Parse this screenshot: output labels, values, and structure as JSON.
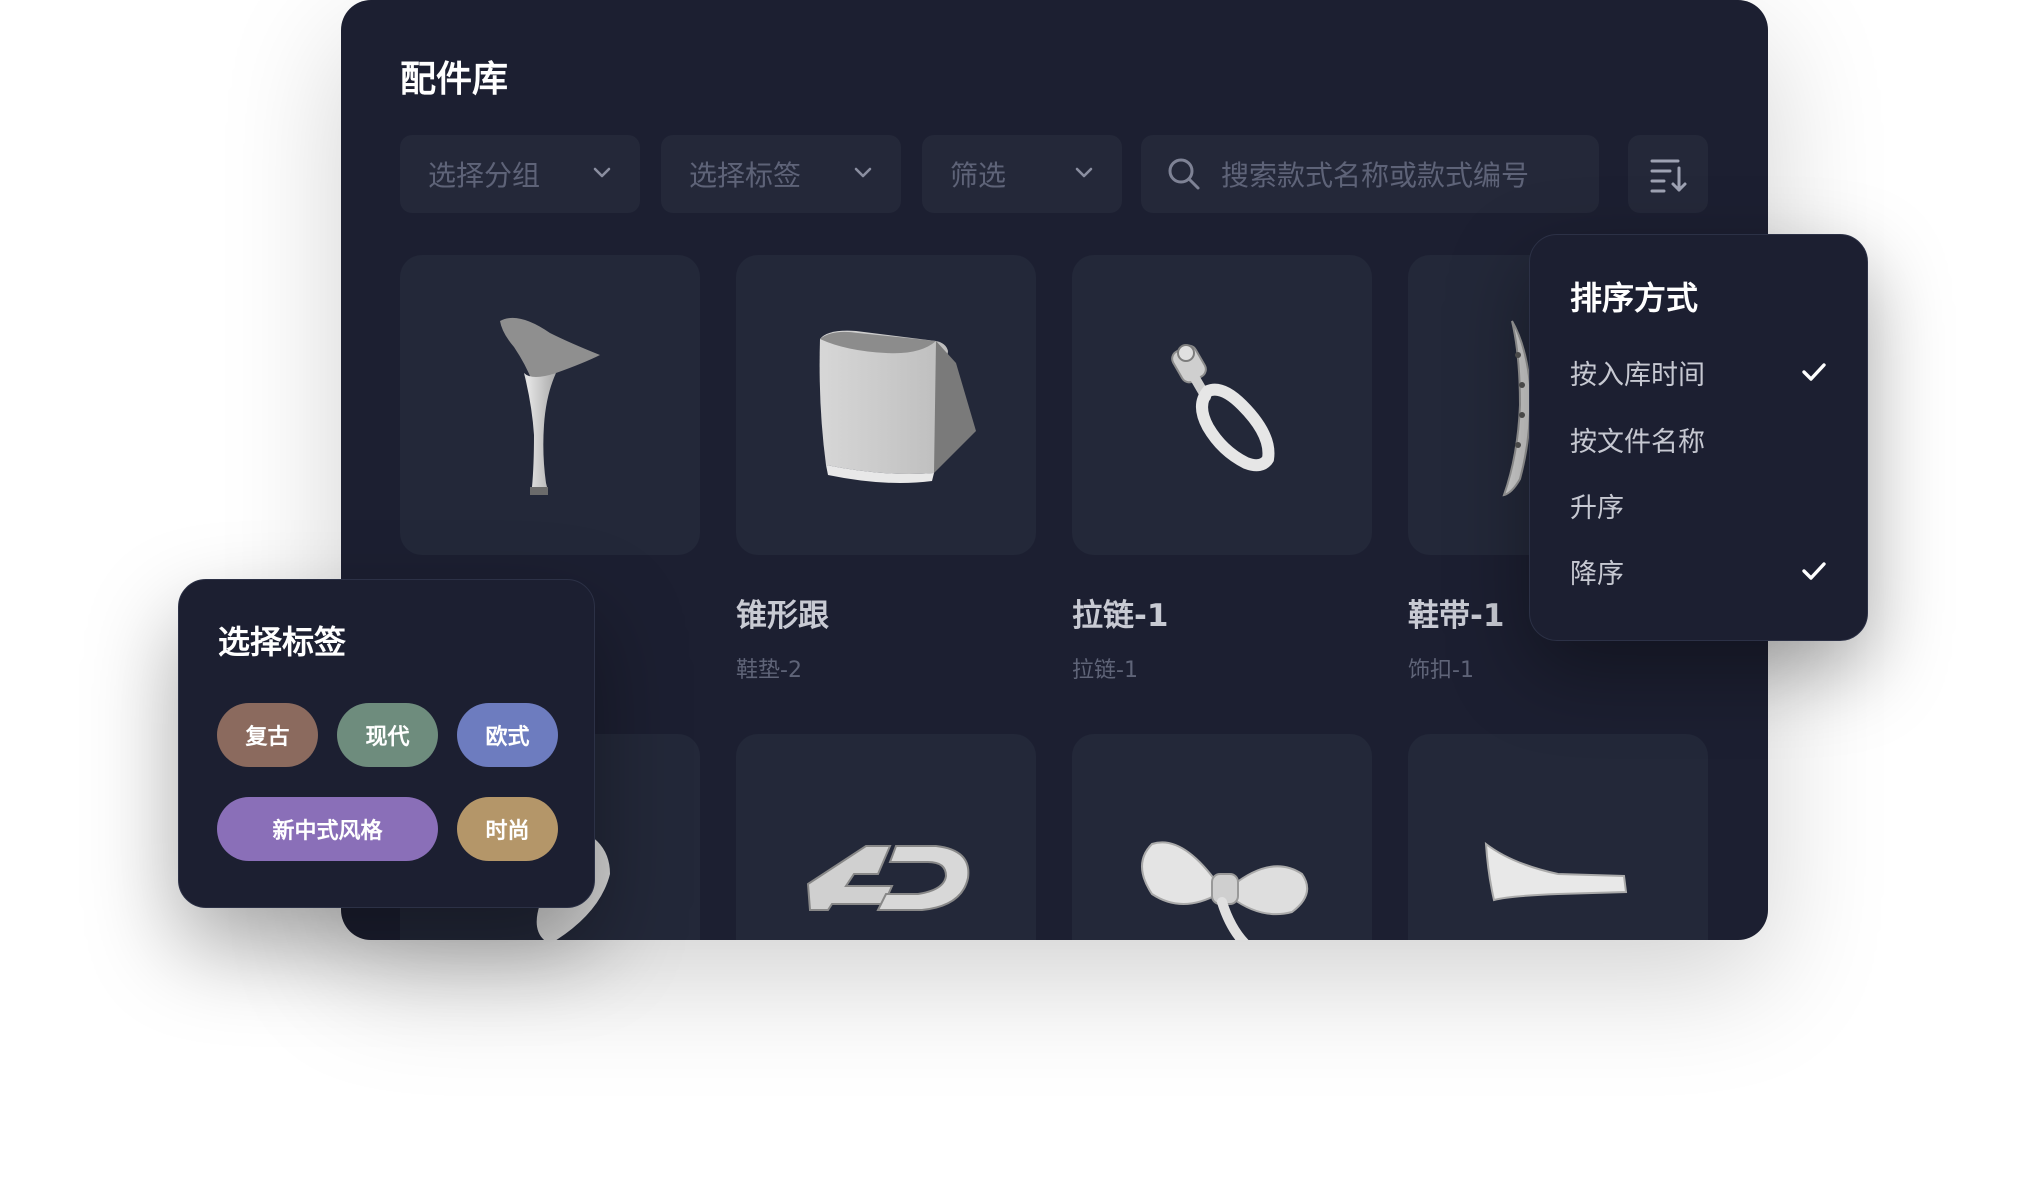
{
  "panel": {
    "title": "配件库",
    "filters": {
      "group_placeholder": "选择分组",
      "tag_placeholder": "选择标签",
      "filter_placeholder": "筛选"
    },
    "search": {
      "placeholder": "搜索款式名称或款式编号"
    }
  },
  "items": [
    {
      "name": "锥形跟",
      "sub": "鞋垫-2",
      "icon": "cone-heel-icon"
    },
    {
      "name": "拉链-1",
      "sub": "拉链-1",
      "icon": "zipper-pull-icon"
    },
    {
      "name": "鞋带-1",
      "sub": "饰扣-1",
      "icon": "strap-icon"
    }
  ],
  "sort_popup": {
    "title": "排序方式",
    "options": [
      {
        "label": "按入库时间",
        "checked": true
      },
      {
        "label": "按文件名称",
        "checked": false
      },
      {
        "label": "升序",
        "checked": false
      },
      {
        "label": "降序",
        "checked": true
      }
    ]
  },
  "tag_popup": {
    "title": "选择标签",
    "tags": [
      {
        "label": "复古",
        "color": "#8b6a5e"
      },
      {
        "label": "现代",
        "color": "#6e8c7d"
      },
      {
        "label": "欧式",
        "color": "#6d7cbf"
      },
      {
        "label": "新中式风格",
        "color": "#8a6fb8"
      },
      {
        "label": "时尚",
        "color": "#b49669"
      }
    ]
  },
  "colors": {
    "panel_bg": "#1c1f31",
    "card_bg": "#232839",
    "input_bg": "#242839"
  }
}
